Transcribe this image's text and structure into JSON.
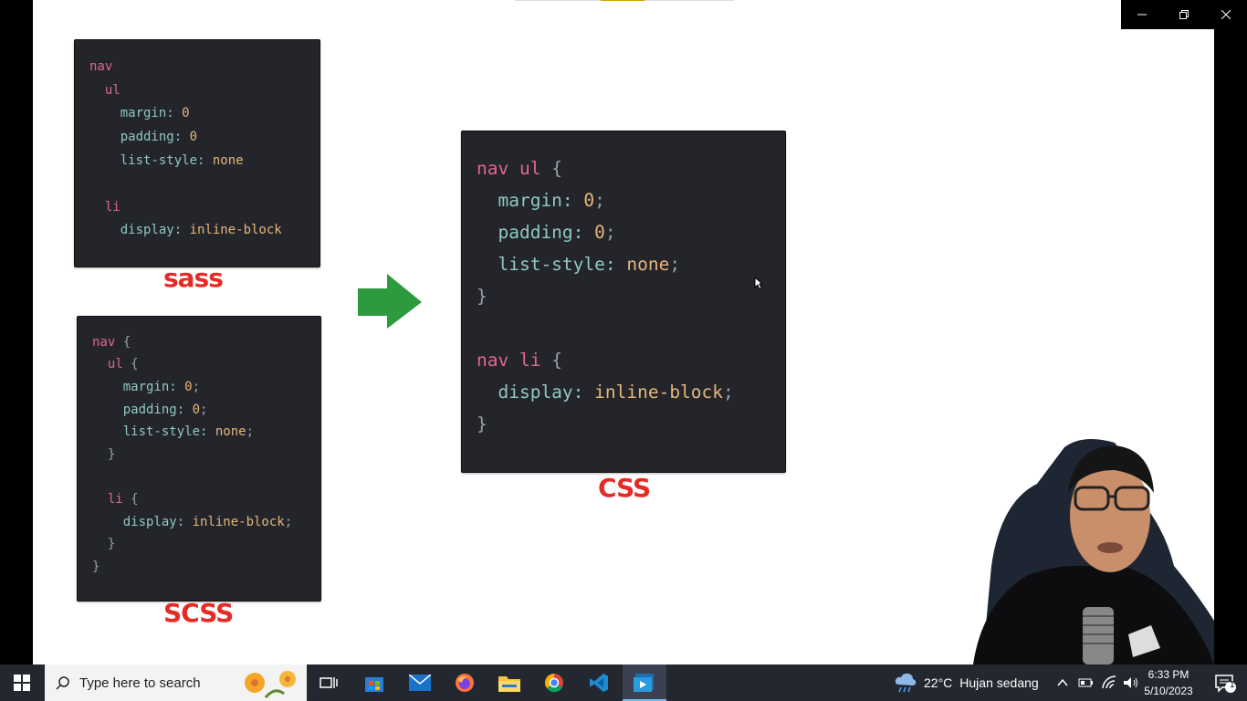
{
  "slide": {
    "sass_label": "sass",
    "scss_label": "SCSS",
    "css_label": "CSS"
  },
  "sass_code": [
    [
      {
        "t": "nav",
        "c": "sel"
      }
    ],
    [
      {
        "t": "  ul",
        "c": "sel"
      }
    ],
    [
      {
        "t": "    margin: ",
        "c": "prop"
      },
      {
        "t": "0",
        "c": "val"
      }
    ],
    [
      {
        "t": "    padding: ",
        "c": "prop"
      },
      {
        "t": "0",
        "c": "val"
      }
    ],
    [
      {
        "t": "    list-style: ",
        "c": "prop"
      },
      {
        "t": "none",
        "c": "val"
      }
    ],
    [],
    [
      {
        "t": "  li",
        "c": "sel"
      }
    ],
    [
      {
        "t": "    display: ",
        "c": "prop"
      },
      {
        "t": "inline-block",
        "c": "val"
      }
    ]
  ],
  "scss_code": [
    [
      {
        "t": "nav ",
        "c": "sel"
      },
      {
        "t": "{",
        "c": "pun"
      }
    ],
    [
      {
        "t": "  ul ",
        "c": "sel"
      },
      {
        "t": "{",
        "c": "pun"
      }
    ],
    [
      {
        "t": "    margin: ",
        "c": "prop"
      },
      {
        "t": "0",
        "c": "val"
      },
      {
        "t": ";",
        "c": "pun"
      }
    ],
    [
      {
        "t": "    padding: ",
        "c": "prop"
      },
      {
        "t": "0",
        "c": "val"
      },
      {
        "t": ";",
        "c": "pun"
      }
    ],
    [
      {
        "t": "    list-style: ",
        "c": "prop"
      },
      {
        "t": "none",
        "c": "val"
      },
      {
        "t": ";",
        "c": "pun"
      }
    ],
    [
      {
        "t": "  }",
        "c": "pun"
      }
    ],
    [],
    [
      {
        "t": "  li ",
        "c": "sel"
      },
      {
        "t": "{",
        "c": "pun"
      }
    ],
    [
      {
        "t": "    display: ",
        "c": "prop"
      },
      {
        "t": "inline-block",
        "c": "val"
      },
      {
        "t": ";",
        "c": "pun"
      }
    ],
    [
      {
        "t": "  }",
        "c": "pun"
      }
    ],
    [
      {
        "t": "}",
        "c": "pun"
      }
    ]
  ],
  "css_code": [
    [
      {
        "t": "nav ul ",
        "c": "sel"
      },
      {
        "t": "{",
        "c": "pun"
      }
    ],
    [
      {
        "t": "  margin: ",
        "c": "prop"
      },
      {
        "t": "0",
        "c": "val"
      },
      {
        "t": ";",
        "c": "pun"
      }
    ],
    [
      {
        "t": "  padding: ",
        "c": "prop"
      },
      {
        "t": "0",
        "c": "val"
      },
      {
        "t": ";",
        "c": "pun"
      }
    ],
    [
      {
        "t": "  list-style: ",
        "c": "prop"
      },
      {
        "t": "none",
        "c": "val"
      },
      {
        "t": ";",
        "c": "pun"
      }
    ],
    [
      {
        "t": "}",
        "c": "pun"
      }
    ],
    [],
    [
      {
        "t": "nav li ",
        "c": "sel"
      },
      {
        "t": "{",
        "c": "pun"
      }
    ],
    [
      {
        "t": "  display: ",
        "c": "prop"
      },
      {
        "t": "inline-block",
        "c": "val"
      },
      {
        "t": ";",
        "c": "pun"
      }
    ],
    [
      {
        "t": "}",
        "c": "pun"
      }
    ]
  ],
  "colors": {
    "label_red": "#e52b26",
    "arrow_green": "#2e9a3e",
    "code_bg": "#23252b",
    "selector": "#e0678a",
    "property": "#8fc8c4",
    "value": "#e6b67a"
  },
  "window_controls": {
    "minimize_icon": "minimize-icon",
    "restore_icon": "restore-icon",
    "close_icon": "close-icon"
  },
  "taskbar": {
    "search_placeholder": "Type here to search",
    "apps": [
      "task-view-icon",
      "microsoft-store-icon",
      "mail-icon",
      "firefox-icon",
      "file-explorer-icon",
      "chrome-icon",
      "vscode-icon",
      "media-player-icon"
    ],
    "weather_temp": "22°C",
    "weather_desc": "Hujan sedang",
    "time": "6:33 PM",
    "date": "5/10/2023",
    "notification_count": "1"
  }
}
